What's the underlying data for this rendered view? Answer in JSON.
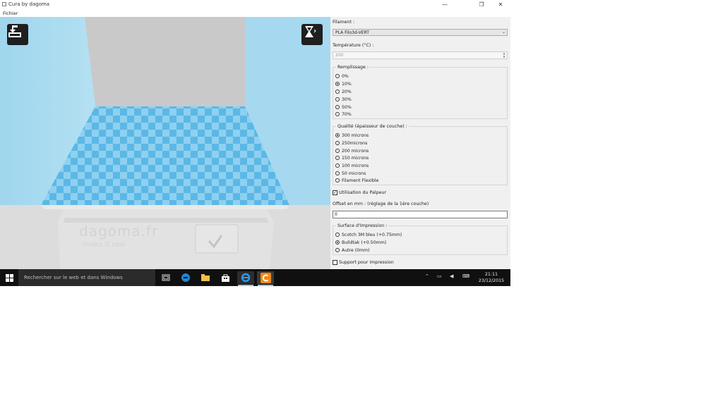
{
  "window": {
    "title": "Cura by dagoma",
    "controls": {
      "minimize": "—",
      "restore": "❐",
      "close": "✕"
    }
  },
  "menu": {
    "items": [
      "Fichier"
    ]
  },
  "viewport": {
    "watermark_brand": "dagoma.fr",
    "watermark_tagline": "make it real",
    "colors": {
      "walls": "#a6d9ef",
      "bed_light": "#8ed0f0",
      "bed_dark": "#5bb8e6",
      "background": "#dcdcdc"
    }
  },
  "panel": {
    "filament": {
      "label": "Filament :",
      "value": "PLA Filo3d-VERT"
    },
    "temperature": {
      "label": "Température (°C) :",
      "value": "200"
    },
    "infill": {
      "title": "Remplissage :",
      "options": [
        "0%",
        "10%",
        "20%",
        "30%",
        "50%",
        "70%"
      ],
      "selected": "10%"
    },
    "quality": {
      "title": "Qualité (épaisseur de couche) :",
      "options": [
        "300 microns",
        "250microns",
        "200 microns",
        "150 microns",
        "100 microns",
        "50 microns",
        "Filament Flexible"
      ],
      "selected": "300 microns"
    },
    "probe": {
      "label": "Utilisation du Palpeur",
      "checked": true
    },
    "offset": {
      "label": "Offset en mm : (réglage de la 1ère couche)",
      "value": "0"
    },
    "surface": {
      "title": "Surface d'Impression :",
      "options": [
        "Scotch 3M bleu (+0.75mm)",
        "Buildtak (+0.50mm)",
        "Autre (0mm)"
      ],
      "selected": "Buildtak (+0.50mm)"
    },
    "support": {
      "label": "Support pour impression",
      "checked": false
    }
  },
  "taskbar": {
    "search_placeholder": "Rechercher sur le web et dans Windows",
    "time": "21:11",
    "date": "23/12/2015"
  }
}
